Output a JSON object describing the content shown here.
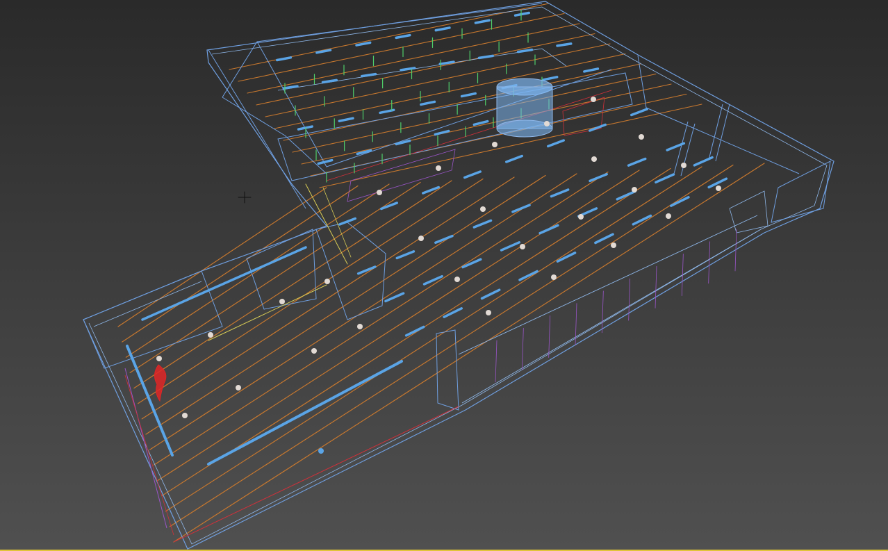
{
  "viewport": {
    "background_top": "#2a2a2a",
    "background_bottom": "#505050",
    "active_border_color": "#e0c43a"
  },
  "scene_colors": {
    "wire_blue": "#6f9fe0",
    "wire_light": "#8fb8ea",
    "ceiling_beam": "#c8782e",
    "light_panel": "#5aa4e6",
    "green_helper": "#4fcf6a",
    "red_outline": "#d2303a",
    "purple_outline": "#9a55c8",
    "spot_light": "#e2dad4",
    "red_object": "#e02626",
    "yellow_line": "#d8cc55",
    "cylinder_fill": "#7cb4ee",
    "cursor": "#101010"
  },
  "icons": {
    "cursor": "crosshair-cursor-icon"
  }
}
